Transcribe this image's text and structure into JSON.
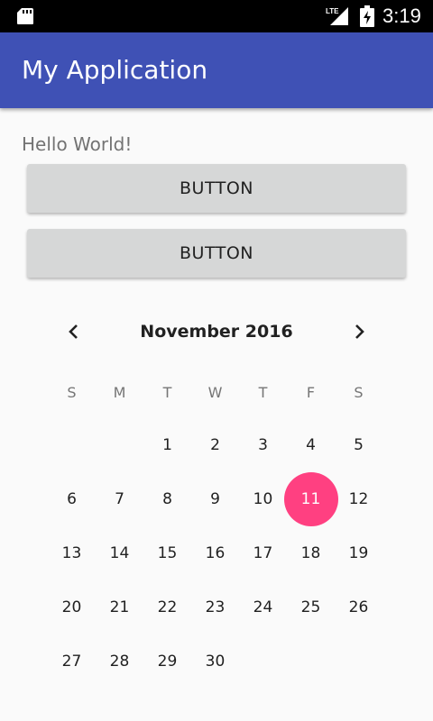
{
  "status_bar": {
    "time": "3:19",
    "network_label": "LTE",
    "icons": [
      "sd-card-icon",
      "lte-signal-icon",
      "battery-icon"
    ]
  },
  "app_bar": {
    "title": "My Application",
    "color": "#3f51b5"
  },
  "main": {
    "hello_text": "Hello World!",
    "buttons": [
      {
        "label": "BUTTON"
      },
      {
        "label": "BUTTON"
      }
    ]
  },
  "calendar": {
    "month_label": "November 2016",
    "weekdays": [
      "S",
      "M",
      "T",
      "W",
      "T",
      "F",
      "S"
    ],
    "first_weekday_index": 2,
    "days_in_month": 30,
    "selected_day": 11,
    "accent_color": "#ff4081",
    "prev_icon": "chevron-left-icon",
    "next_icon": "chevron-right-icon"
  }
}
